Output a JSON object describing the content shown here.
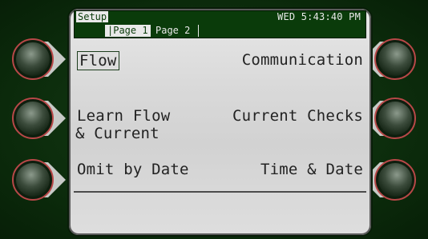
{
  "header": {
    "title": "Setup",
    "clock": "WED 5:43:40 PM"
  },
  "tabs": [
    {
      "label": "|Page 1"
    },
    {
      "label": "Page 2"
    }
  ],
  "menu": {
    "left": [
      {
        "label": "Flow"
      },
      {
        "label": "Learn Flow"
      },
      {
        "label": " & Current"
      },
      {
        "label": "Omit by Date"
      }
    ],
    "right": [
      {
        "label": "Communication"
      },
      {
        "label": "Current Checks"
      },
      {
        "label": "Time & Date"
      }
    ]
  },
  "colors": {
    "header_bg": "#0a3b0a",
    "lcd_bg": "#d9d9d9",
    "bezel": "#0b2a0b",
    "button_ring": "#b84848"
  },
  "icons": {
    "side_button": "round-softkey-button"
  }
}
